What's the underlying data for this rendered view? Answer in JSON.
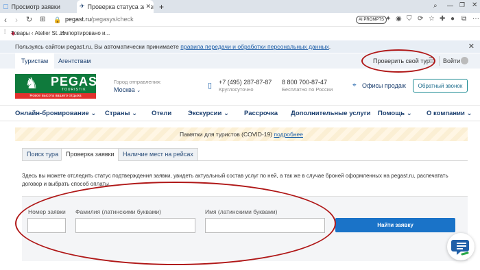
{
  "browser": {
    "tabs": [
      {
        "label": "Просмотр заявки",
        "active": false
      },
      {
        "label": "Проверка статуса заявки",
        "active": true
      }
    ],
    "new_tab": "+",
    "url_host": "pegast.ru",
    "url_path": "/pegasys/check",
    "ai_prompts": "AI PROMPTS",
    "bookmarks": [
      "Товары ‹ Atelier St...",
      "Импортировано и..."
    ]
  },
  "cookie_notice": {
    "text": "Пользуясь сайтом pegast.ru, Вы автоматически принимаете",
    "link": "правила передачи и обработки персональных данных",
    "suffix": "."
  },
  "top_nav": {
    "tabs": [
      "Туристам",
      "Агентствам"
    ],
    "check_tour": "Проверить свой тур",
    "login": "Войти"
  },
  "header": {
    "logo_text": "PEGAS",
    "logo_sub": "TOURISTIK",
    "logo_slogan": "Новое высота вашего отдыха",
    "city_label": "Город отправления:",
    "city_value": "Москва",
    "phone1": "+7 (495) 287-87-87",
    "phone1_note": "Круглосуточно",
    "phone2": "8 800 700-87-47",
    "phone2_note": "Бесплатно по России",
    "offices": "Офисы продаж",
    "callback": "Обратный звонок"
  },
  "main_menu": [
    "Онлайн-бронирование",
    "Страны",
    "Отели",
    "Экскурсии",
    "Рассрочка",
    "Дополнительные услуги",
    "Помощь",
    "О компании"
  ],
  "covid": {
    "text": "Памятки для туристов (COVID-19)",
    "link": "подробнее"
  },
  "page_tabs": [
    "Поиск тура",
    "Проверка заявки",
    "Наличие мест на рейсах"
  ],
  "description": "Здесь вы можете отследить статус подтверждения заявки, увидеть актуальный состав услуг по ней, а так же в случае броней оформленных на pegast.ru, распечатать договор и выбрать способ оплаты.",
  "form": {
    "order_number_label": "Номер заявки",
    "surname_label": "Фамилия (латинскими буквами)",
    "name_label": "Имя (латинскими буквами)",
    "order_number_value": "",
    "surname_value": "",
    "name_value": "",
    "submit": "Найти заявку"
  },
  "colors": {
    "accent": "#1a73c8",
    "brand_green": "#0f7a3c",
    "annotation_red": "#b01818"
  }
}
